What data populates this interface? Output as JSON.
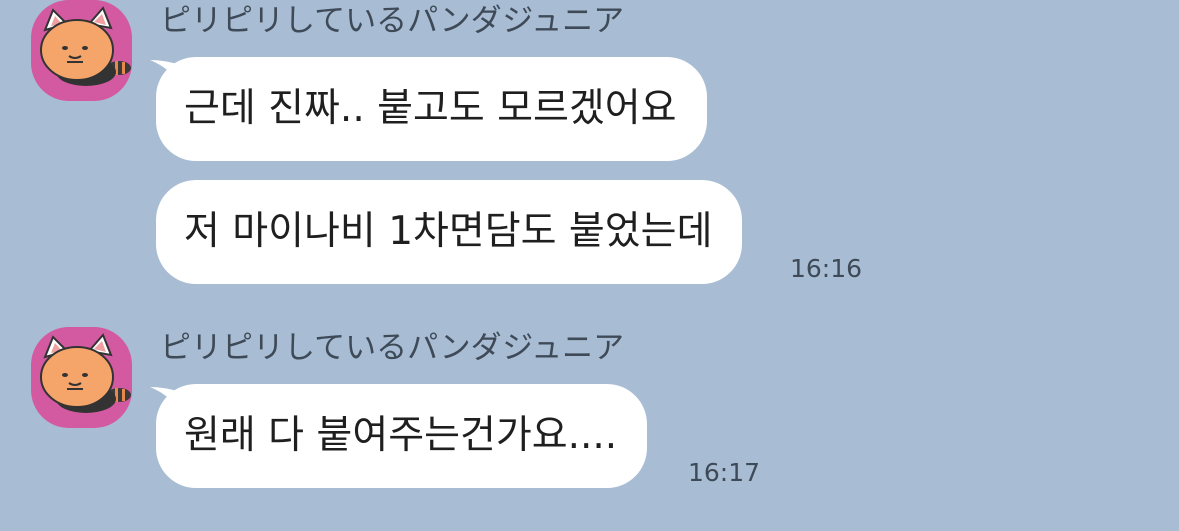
{
  "chat": {
    "background_color": "#a8bdd3",
    "avatar_color": "#d35aa0",
    "groups": [
      {
        "sender_name": "ピリピリしているパンダジュニア",
        "messages": [
          {
            "text": "근데 진짜.. 붙고도 모르겠어요",
            "time": ""
          },
          {
            "text": "저 마이나비 1차면담도 붙었는데",
            "time": "16:16"
          }
        ]
      },
      {
        "sender_name": "ピリピリしているパンダジュニア",
        "messages": [
          {
            "text": "원래 다 붙여주는건가요....",
            "time": "16:17"
          }
        ]
      }
    ]
  }
}
